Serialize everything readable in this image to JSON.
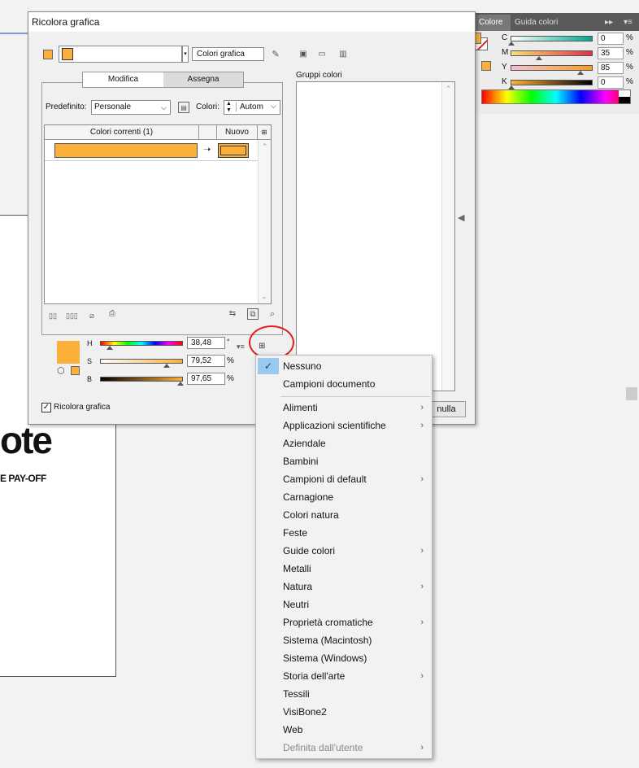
{
  "dialog": {
    "title": "Ricolora grafica",
    "artwork_colors_field": "Colori grafica",
    "tabs": [
      "Modifica",
      "Assegna"
    ],
    "preset_label": "Predefinito:",
    "preset_value": "Personale",
    "colors_label": "Colori:",
    "colors_value": "Autom",
    "table_headers": {
      "current": "Colori correnti (1)",
      "new": "Nuovo"
    },
    "color_groups_label": "Gruppi colori",
    "hsb": {
      "h_label": "H",
      "h_value": "38,48",
      "h_unit": "°",
      "s_label": "S",
      "s_value": "79,52",
      "s_unit": "%",
      "b_label": "B",
      "b_value": "97,65",
      "b_unit": "%"
    },
    "recolor_checkbox": "Ricolora grafica",
    "cancel_partial": "nulla",
    "current_color": "#fbb03b"
  },
  "color_panel": {
    "tabs": [
      "Colore",
      "Guida colori"
    ],
    "menu_glyphs": [
      "▸▸",
      "▾≡"
    ],
    "cmyk": [
      {
        "label": "C",
        "value": "0",
        "unit": "%"
      },
      {
        "label": "M",
        "value": "35",
        "unit": "%"
      },
      {
        "label": "Y",
        "value": "85",
        "unit": "%"
      },
      {
        "label": "K",
        "value": "0",
        "unit": "%"
      }
    ]
  },
  "document": {
    "brand_fragment": "ote",
    "tagline_fragment": "E PAY-OFF"
  },
  "library_menu": {
    "items": [
      {
        "label": "Nessuno",
        "checked": true
      },
      {
        "label": "Campioni documento"
      },
      {
        "separator": true
      },
      {
        "label": "Alimenti",
        "submenu": true
      },
      {
        "label": "Applicazioni scientifiche",
        "submenu": true
      },
      {
        "label": "Aziendale"
      },
      {
        "label": "Bambini"
      },
      {
        "label": "Campioni di default",
        "submenu": true
      },
      {
        "label": "Carnagione"
      },
      {
        "label": "Colori natura"
      },
      {
        "label": "Feste"
      },
      {
        "label": "Guide colori",
        "submenu": true
      },
      {
        "label": "Metalli"
      },
      {
        "label": "Natura",
        "submenu": true
      },
      {
        "label": "Neutri"
      },
      {
        "label": "Proprietà cromatiche",
        "submenu": true
      },
      {
        "label": "Sistema (Macintosh)"
      },
      {
        "label": "Sistema (Windows)"
      },
      {
        "label": "Storia dell'arte",
        "submenu": true
      },
      {
        "label": "Tessili"
      },
      {
        "label": "VisiBone2"
      },
      {
        "label": "Web"
      },
      {
        "label": "Definita dall'utente",
        "submenu": true,
        "disabled": true
      }
    ]
  },
  "colors": {
    "orange": "#fbb03b",
    "check_highlight": "#99c9ef",
    "annotation_red": "#e02020"
  }
}
